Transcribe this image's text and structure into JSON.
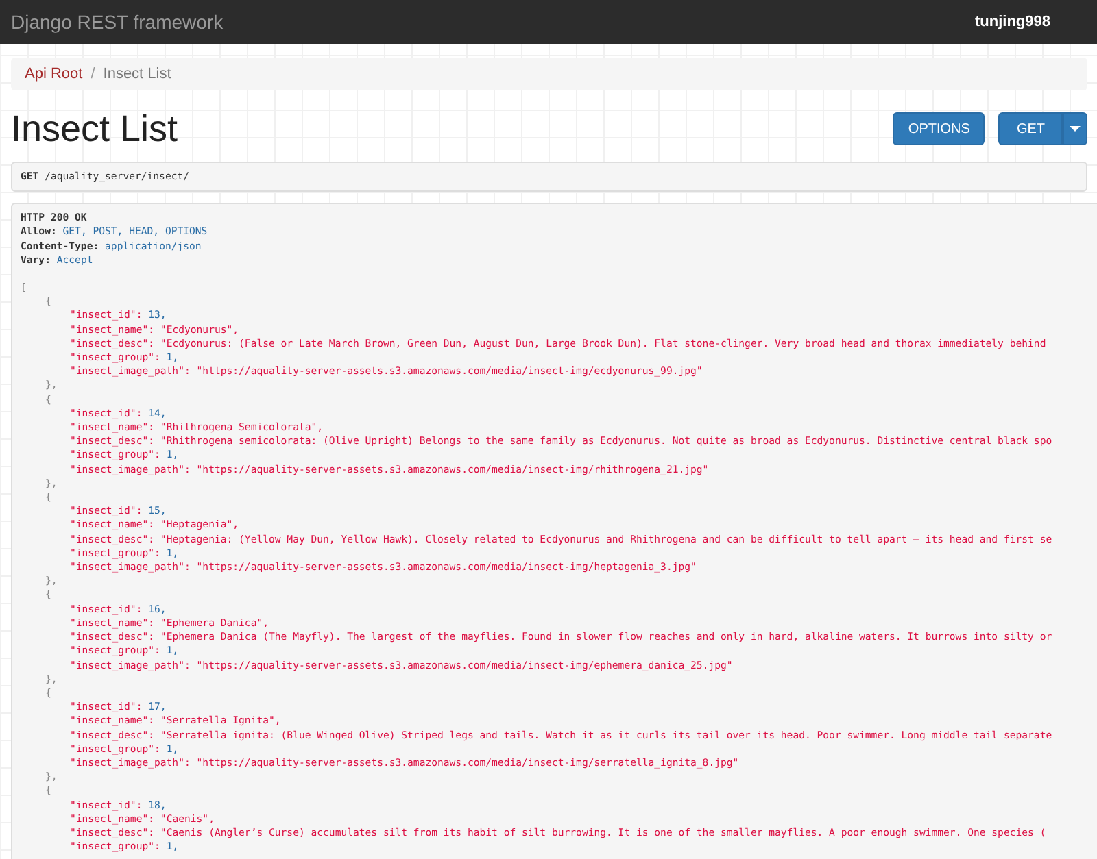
{
  "navbar": {
    "brand": "Django REST framework",
    "user": "tunjing998"
  },
  "breadcrumb": [
    {
      "label": "Api Root",
      "current": false
    },
    {
      "label": "Insect List",
      "current": true
    }
  ],
  "breadcrumb_separator": "/",
  "title": "Insect List",
  "buttons": [
    {
      "label": "OPTIONS",
      "kind": "plain"
    },
    {
      "label": "GET",
      "kind": "split"
    }
  ],
  "request": {
    "method": "GET",
    "path": "/aquality_server/insect/"
  },
  "response": {
    "status": "HTTP 200 OK",
    "headers": [
      {
        "name": "Allow:",
        "value": "GET, POST, HEAD, OPTIONS"
      },
      {
        "name": "Content-Type:",
        "value": "application/json"
      },
      {
        "name": "Vary:",
        "value": "Accept"
      }
    ],
    "open": "[",
    "items": [
      {
        "open": "{",
        "close": "},",
        "fields": [
          {
            "key": "\"insect_id\":",
            "value": "13,",
            "kind": "number"
          },
          {
            "key": "\"insect_name\":",
            "value": "\"Ecdyonurus\",",
            "kind": "string"
          },
          {
            "key": "\"insect_desc\":",
            "value": "\"Ecdyonurus: (False or Late March Brown, Green Dun, August Dun, Large Brook Dun). Flat stone-clinger. Very broad head and thorax immediately behind",
            "kind": "string"
          },
          {
            "key": "\"insect_group\":",
            "value": "1,",
            "kind": "number"
          },
          {
            "key": "\"insect_image_path\":",
            "value": "\"https://aquality-server-assets.s3.amazonaws.com/media/insect-img/ecdyonurus_99.jpg\"",
            "kind": "string"
          }
        ]
      },
      {
        "open": "{",
        "close": "},",
        "fields": [
          {
            "key": "\"insect_id\":",
            "value": "14,",
            "kind": "number"
          },
          {
            "key": "\"insect_name\":",
            "value": "\"Rhithrogena Semicolorata\",",
            "kind": "string"
          },
          {
            "key": "\"insect_desc\":",
            "value": "\"Rhithrogena semicolorata: (Olive Upright) Belongs to the same family as Ecdyonurus. Not quite as broad as Ecdyonurus. Distinctive central black spo",
            "kind": "string"
          },
          {
            "key": "\"insect_group\":",
            "value": "1,",
            "kind": "number"
          },
          {
            "key": "\"insect_image_path\":",
            "value": "\"https://aquality-server-assets.s3.amazonaws.com/media/insect-img/rhithrogena_21.jpg\"",
            "kind": "string"
          }
        ]
      },
      {
        "open": "{",
        "close": "},",
        "fields": [
          {
            "key": "\"insect_id\":",
            "value": "15,",
            "kind": "number"
          },
          {
            "key": "\"insect_name\":",
            "value": "\"Heptagenia\",",
            "kind": "string"
          },
          {
            "key": "\"insect_desc\":",
            "value": "\"Heptagenia: (Yellow May Dun, Yellow Hawk). Closely related to Ecdyonurus and Rhithrogena and can be difficult to tell apart – its head and first se",
            "kind": "string"
          },
          {
            "key": "\"insect_group\":",
            "value": "1,",
            "kind": "number"
          },
          {
            "key": "\"insect_image_path\":",
            "value": "\"https://aquality-server-assets.s3.amazonaws.com/media/insect-img/heptagenia_3.jpg\"",
            "kind": "string"
          }
        ]
      },
      {
        "open": "{",
        "close": "},",
        "fields": [
          {
            "key": "\"insect_id\":",
            "value": "16,",
            "kind": "number"
          },
          {
            "key": "\"insect_name\":",
            "value": "\"Ephemera Danica\",",
            "kind": "string"
          },
          {
            "key": "\"insect_desc\":",
            "value": "\"Ephemera Danica (The Mayfly). The largest of the mayflies. Found in slower flow reaches and only in hard, alkaline waters. It burrows into silty or",
            "kind": "string"
          },
          {
            "key": "\"insect_group\":",
            "value": "1,",
            "kind": "number"
          },
          {
            "key": "\"insect_image_path\":",
            "value": "\"https://aquality-server-assets.s3.amazonaws.com/media/insect-img/ephemera_danica_25.jpg\"",
            "kind": "string"
          }
        ]
      },
      {
        "open": "{",
        "close": "},",
        "fields": [
          {
            "key": "\"insect_id\":",
            "value": "17,",
            "kind": "number"
          },
          {
            "key": "\"insect_name\":",
            "value": "\"Serratella Ignita\",",
            "kind": "string"
          },
          {
            "key": "\"insect_desc\":",
            "value": "\"Serratella ignita: (Blue Winged Olive) Striped legs and tails. Watch it as it curls its tail over its head. Poor swimmer. Long middle tail separate",
            "kind": "string"
          },
          {
            "key": "\"insect_group\":",
            "value": "1,",
            "kind": "number"
          },
          {
            "key": "\"insect_image_path\":",
            "value": "\"https://aquality-server-assets.s3.amazonaws.com/media/insect-img/serratella_ignita_8.jpg\"",
            "kind": "string"
          }
        ]
      },
      {
        "open": "{",
        "fields": [
          {
            "key": "\"insect_id\":",
            "value": "18,",
            "kind": "number"
          },
          {
            "key": "\"insect_name\":",
            "value": "\"Caenis\",",
            "kind": "string"
          },
          {
            "key": "\"insect_desc\":",
            "value": "\"Caenis (Angler’s Curse) accumulates silt from its habit of silt burrowing. It is one of the smaller mayflies. A poor enough swimmer. One species (",
            "kind": "string"
          },
          {
            "key": "\"insect_group\":",
            "value": "1,",
            "kind": "number"
          }
        ]
      }
    ]
  }
}
